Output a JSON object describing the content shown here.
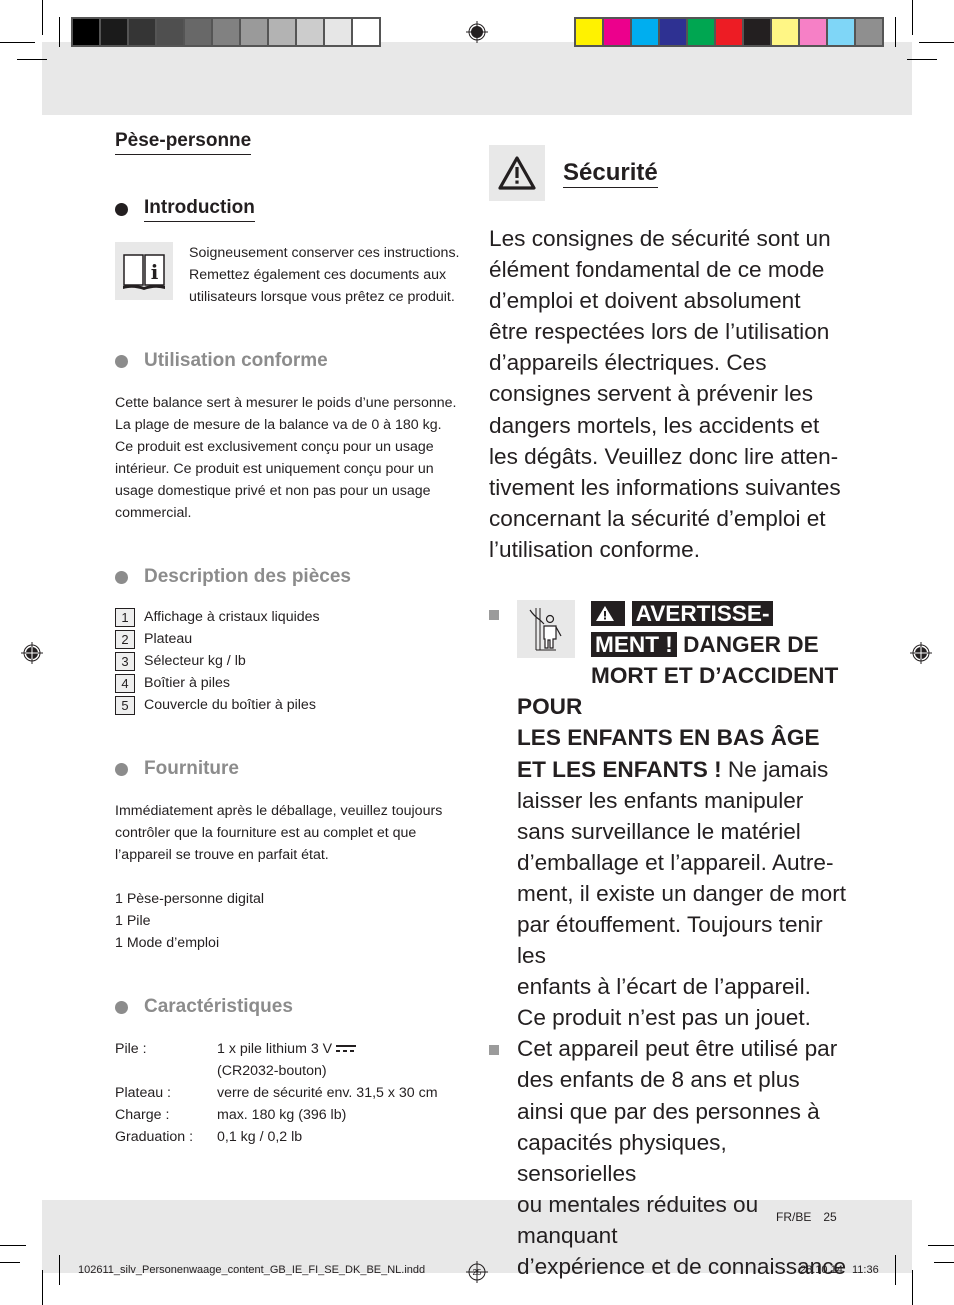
{
  "color_bars": {
    "gray": [
      "#000000",
      "#1b1b1b",
      "#353535",
      "#4f4f4f",
      "#686868",
      "#818181",
      "#9a9a9a",
      "#b3b3b3",
      "#cccccc",
      "#e6e6e6",
      "#ffffff"
    ],
    "color": [
      "#fff200",
      "#ec008c",
      "#00aeef",
      "#2e3192",
      "#00a651",
      "#ed1c24",
      "#231f20",
      "#fff685",
      "#f680c6",
      "#7fd6f7",
      "#8f8f8f"
    ]
  },
  "left": {
    "doc_title": "Pèse-personne",
    "introduction": {
      "heading": "Introduction",
      "icon": "manual-info-icon",
      "lines": [
        "Soigneusement conserver ces instructions.",
        "Remettez également ces documents aux",
        "utilisateurs lorsque vous prêtez ce produit."
      ]
    },
    "utilisation": {
      "heading": "Utilisation conforme",
      "lines": [
        "Cette balance sert à mesurer le poids d’une personne.",
        "La plage de mesure de la balance va de 0 à 180 kg.",
        "Ce produit est exclusivement conçu pour un usage",
        "intérieur. Ce produit est uniquement conçu pour un",
        "usage domestique privé et non pas pour un usage",
        "commercial."
      ]
    },
    "description": {
      "heading": "Description des pièces",
      "parts": [
        {
          "num": "1",
          "label": "Affichage à cristaux liquides"
        },
        {
          "num": "2",
          "label": "Plateau"
        },
        {
          "num": "3",
          "label": "Sélecteur kg / lb"
        },
        {
          "num": "4",
          "label": "Boîtier à piles"
        },
        {
          "num": "5",
          "label": "Couvercle du boîtier à piles"
        }
      ]
    },
    "fourniture": {
      "heading": "Fourniture",
      "lines": [
        "Immédiatement après le déballage, veuillez toujours",
        "contrôler que la fourniture est au complet et que",
        "l’appareil se trouve en parfait état."
      ],
      "items": [
        "1 Pèse-personne digital",
        "1 Pile",
        "1 Mode d’emploi"
      ]
    },
    "caracteristiques": {
      "heading": "Caractéristiques",
      "rows": [
        {
          "label": "Pile :",
          "value": "1 x pile lithium 3 V",
          "value2": "(CR2032-bouton)"
        },
        {
          "label": "Plateau :",
          "value": "verre de sécurité env. 31,5 x 30 cm"
        },
        {
          "label": "Charge :",
          "value": "max. 180 kg (396 lb)"
        },
        {
          "label": "Graduation :",
          "value": "0,1 kg / 0,2 lb"
        }
      ]
    }
  },
  "right": {
    "heading": "Sécurité",
    "intro_lines": [
      "Les consignes de sécurité sont un",
      "élément fondamental de ce mode",
      "d’emploi et doivent absolument",
      "être respectées lors de l’utilisation",
      "d’appareils électriques. Ces",
      "consignes servent à prévenir les",
      "dangers mortels, les accidents et",
      "les dégâts. Veuillez donc lire atten-",
      "tivement les informations suivantes",
      "concernant la sécurité d’emploi et",
      "l’utilisation conforme."
    ],
    "warning": {
      "badge_1": "AVERTISSE-",
      "badge_2": "MENT !",
      "bold_1": "DANGER DE",
      "bold_2": "MORT ET D’ACCIDENT POUR",
      "bold_3": "LES ENFANTS EN BAS ÂGE",
      "bold_4": "ET LES ENFANTS !",
      "text_after": "Ne jamais",
      "lines": [
        "laisser les enfants manipuler",
        "sans surveillance le matériel",
        "d’emballage et l’appareil. Autre-",
        "ment, il existe un danger de mort",
        "par étouffement. Toujours tenir les",
        "enfants à l’écart de l’appareil.",
        "Ce produit n’est pas un jouet."
      ]
    },
    "bullet2_lines": [
      "Cet appareil peut être utilisé par",
      "des enfants de 8 ans et plus",
      "ainsi que par des personnes à",
      "capacités physiques, sensorielles",
      "ou mentales réduites ou manquant",
      "d’expérience et de connaissance"
    ]
  },
  "footer": {
    "lang": "FR/BE",
    "page": "25",
    "slug_file": "102611_silv_Personenwaage_content_GB_IE_FI_SE_DK_BE_NL.indd",
    "slug_page": "25",
    "slug_date": "28.10.14",
    "slug_time": "11:36"
  }
}
